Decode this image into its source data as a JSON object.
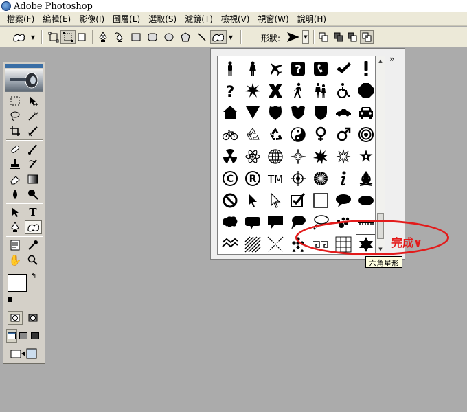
{
  "window": {
    "title": "Adobe Photoshop"
  },
  "menu": [
    "檔案(F)",
    "編輯(E)",
    "影像(I)",
    "圖層(L)",
    "選取(S)",
    "濾鏡(T)",
    "檢視(V)",
    "視窗(W)",
    "說明(H)"
  ],
  "options_bar": {
    "shape_label": "形狀:"
  },
  "shape_picker": {
    "menu_toggle": "»",
    "rows": [
      [
        "man-icon",
        "woman-icon",
        "airplane-icon",
        "help-question-icon",
        "phone-icon",
        "checkmark-icon",
        "exclamation-icon"
      ],
      [
        "question-mark-icon",
        "burst-icon",
        "x-icon",
        "pedestrian-icon",
        "school-crossing-icon",
        "wheelchair-icon",
        "stop-octagon-icon"
      ],
      [
        "house-icon",
        "yield-triangle-icon",
        "shield-badge-icon",
        "crest-icon",
        "shield-icon",
        "sedan-car-icon",
        "car-front-icon"
      ],
      [
        "bicycle-icon",
        "recycle-outline-icon",
        "recycle-icon",
        "yin-yang-icon",
        "female-symbol-icon",
        "male-symbol-icon",
        "target-icon"
      ],
      [
        "radiation-icon",
        "atom-icon",
        "globe-icon",
        "compass-rose-icon",
        "starburst-icon",
        "burst-outline-icon",
        "sheriff-star-icon"
      ],
      [
        "copyright-icon",
        "registered-icon",
        "trademark-icon",
        "crosshair-icon",
        "radial-lines-icon",
        "info-icon",
        "campfire-icon"
      ],
      [
        "no-symbol-icon",
        "cursor-arrow-icon",
        "cursor-outline-icon",
        "checkbox-icon",
        "blank-square-icon",
        "speech-bubble-icon",
        "ellipse-bubble-icon"
      ],
      [
        "cloud-bubble-icon",
        "speech-rect-icon",
        "callout-box-icon",
        "talk-bubble-icon",
        "thought-bubble-icon",
        "paw-dots-icon",
        "stitch-line-icon"
      ],
      [
        "zigzag-icon",
        "diagonal-hatch-icon",
        "x-pattern-icon",
        "diamond-checker-icon",
        "greek-key-icon",
        "grid-icon",
        "hexagram-star-icon"
      ]
    ],
    "tooltip": "六角星形"
  },
  "annotation": {
    "text": "完成∨",
    "color": "#e31b1b"
  }
}
